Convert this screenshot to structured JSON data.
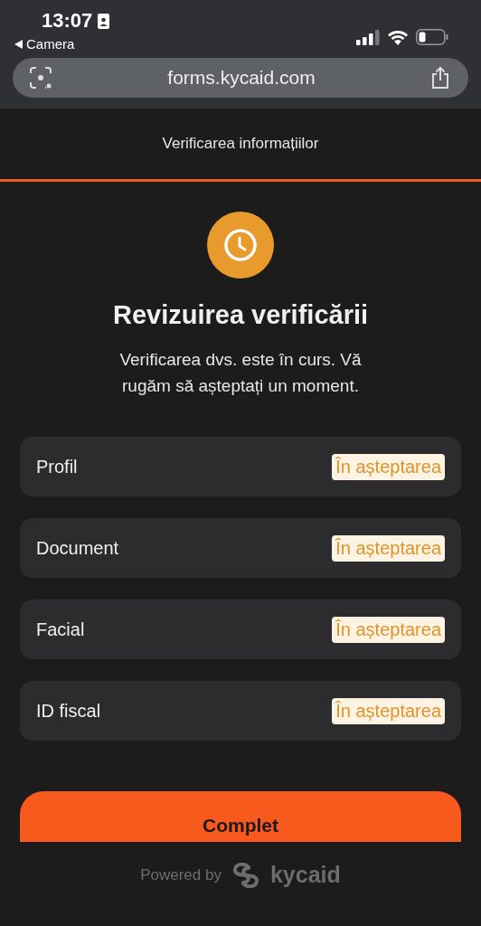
{
  "status_bar": {
    "time": "13:07",
    "back_label": "Camera"
  },
  "browser": {
    "url": "forms.kycaid.com"
  },
  "header": {
    "title": "Verificarea informațiilor"
  },
  "review": {
    "title": "Revizuirea verificării",
    "message": "Verificarea dvs. este în curs. Vă rugăm să așteptați un moment."
  },
  "steps": [
    {
      "name": "Profil",
      "status": "În așteptarea"
    },
    {
      "name": "Document",
      "status": "În așteptarea"
    },
    {
      "name": "Facial",
      "status": "În așteptarea"
    },
    {
      "name": "ID fiscal",
      "status": "În așteptarea"
    }
  ],
  "button": {
    "label": "Complet"
  },
  "footer": {
    "powered_by": "Powered by",
    "brand": "kycaid"
  }
}
